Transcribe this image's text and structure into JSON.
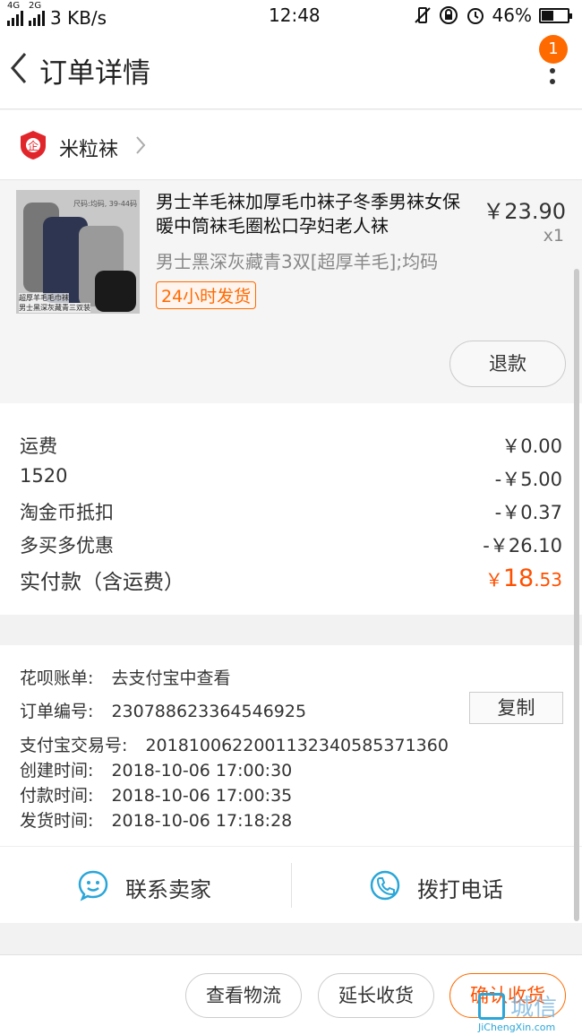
{
  "status_bar": {
    "net_4g": "4G",
    "net_2g": "2G",
    "speed": "3 KB/s",
    "time": "12:48",
    "battery": "46%",
    "battery_level": 0.46
  },
  "header": {
    "title": "订单详情",
    "notification_count": "1"
  },
  "shop": {
    "name": "米粒袜",
    "logo_char": "企"
  },
  "item": {
    "title": "男士羊毛袜加厚毛巾袜子冬季男袜女保暖中筒袜毛圈松口孕妇老人袜",
    "price": "￥23.90",
    "quantity": "x1",
    "sku": "男士黑深灰藏青3双[超厚羊毛];均码",
    "tag": "24小时发货",
    "refund_label": "退款",
    "image_text": {
      "size_label": "尺码:均码, 39-44码",
      "caption_line1": "超厚羊毛毛巾袜",
      "caption_line2": "男士黑深灰藏青三双装"
    }
  },
  "costs": {
    "rows": [
      {
        "label": "运费",
        "value": "￥0.00"
      },
      {
        "label": "1520",
        "value": "-￥5.00"
      },
      {
        "label": "淘金币抵扣",
        "value": "-￥0.37"
      },
      {
        "label": "多买多优惠",
        "value": "-￥26.10"
      }
    ],
    "total_label": "实付款（含运费）",
    "total_currency": "￥",
    "total_int": "18",
    "total_dec": ".53"
  },
  "info": {
    "huabei_label": "花呗账单:",
    "huabei_value": "去支付宝中查看",
    "order_no_label": "订单编号:",
    "order_no": "2307886233645469​25",
    "copy_label": "复制",
    "alipay_label": "支付宝交易号:",
    "alipay_no": "2018100622001132340585371360",
    "created_label": "创建时间:",
    "created": "2018-10-06 17:00:30",
    "paid_label": "付款时间:",
    "paid": "2018-10-06 17:00:35",
    "shipped_label": "发货时间:",
    "shipped": "2018-10-06 17:18:28"
  },
  "contact": {
    "seller_label": "联系卖家",
    "phone_label": "拨打电话"
  },
  "actions": {
    "logistics": "查看物流",
    "extend": "延长收货",
    "confirm": "确认收货"
  },
  "watermark": {
    "text": "城信",
    "url": "JiChengXin.com"
  },
  "colors": {
    "accent": "#ff6a00",
    "price_red": "#ff5000",
    "contact_blue": "#2aa6d8"
  }
}
